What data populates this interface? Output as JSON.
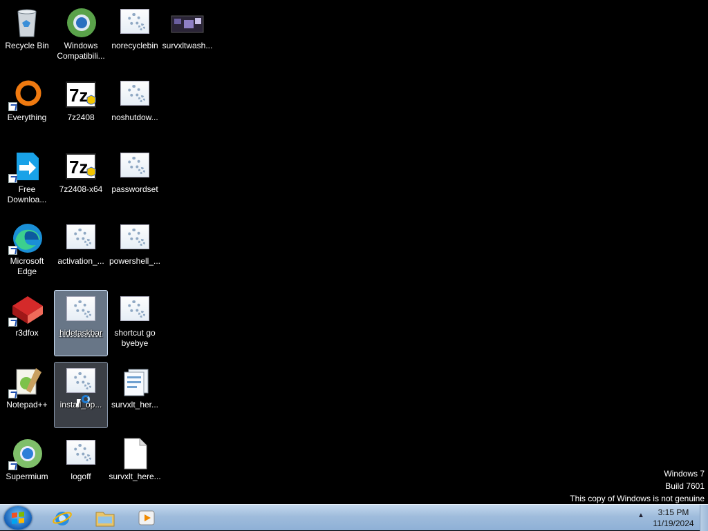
{
  "desktop": {
    "icons": [
      {
        "label": "Recycle Bin",
        "icon": "recycle-bin-icon"
      },
      {
        "label": "Windows Compatibili...",
        "icon": "windows-compatibility-icon"
      },
      {
        "label": "norecyclebin",
        "icon": "script-icon"
      },
      {
        "label": "survxltwash...",
        "icon": "image-thumbnail-icon"
      },
      {
        "label": "Everything",
        "icon": "everything-icon"
      },
      {
        "label": "7z2408",
        "icon": "7zip-installer-icon"
      },
      {
        "label": "noshutdow...",
        "icon": "script-icon"
      },
      {
        "label": "Free Downloa...",
        "icon": "free-download-manager-icon"
      },
      {
        "label": "7z2408-x64",
        "icon": "7zip-installer-icon"
      },
      {
        "label": "passwordset",
        "icon": "script-icon"
      },
      {
        "label": "Microsoft Edge",
        "icon": "edge-icon"
      },
      {
        "label": "activation_...",
        "icon": "script-icon"
      },
      {
        "label": "powershell_...",
        "icon": "script-icon"
      },
      {
        "label": "r3dfox",
        "icon": "r3dfox-icon"
      },
      {
        "label": "hidetaskbar",
        "icon": "script-icon"
      },
      {
        "label": "shortcut go byebye",
        "icon": "script-icon"
      },
      {
        "label": "Notepad++",
        "icon": "notepad-plus-plus-icon"
      },
      {
        "label": "install_op...",
        "icon": "script-icon"
      },
      {
        "label": "survxlt_her...",
        "icon": "documents-icon"
      },
      {
        "label": "Supermium",
        "icon": "supermium-icon"
      },
      {
        "label": "logoff",
        "icon": "script-icon"
      },
      {
        "label": "survxlt_here...",
        "icon": "blank-file-icon"
      }
    ]
  },
  "watermark": {
    "line1": "Windows 7",
    "line2": "Build 7601",
    "line3": "This copy of Windows is not genuine"
  },
  "taskbar": {
    "pinned": [
      "internet-explorer-icon",
      "windows-explorer-icon",
      "media-player-icon"
    ],
    "clock_time": "3:15 PM",
    "clock_date": "11/19/2024",
    "tray_arrow": "▲"
  },
  "colors": {
    "desktop_bg": "#000000",
    "taskbar": "#a9c4e3",
    "selection": "#bed7f5"
  }
}
